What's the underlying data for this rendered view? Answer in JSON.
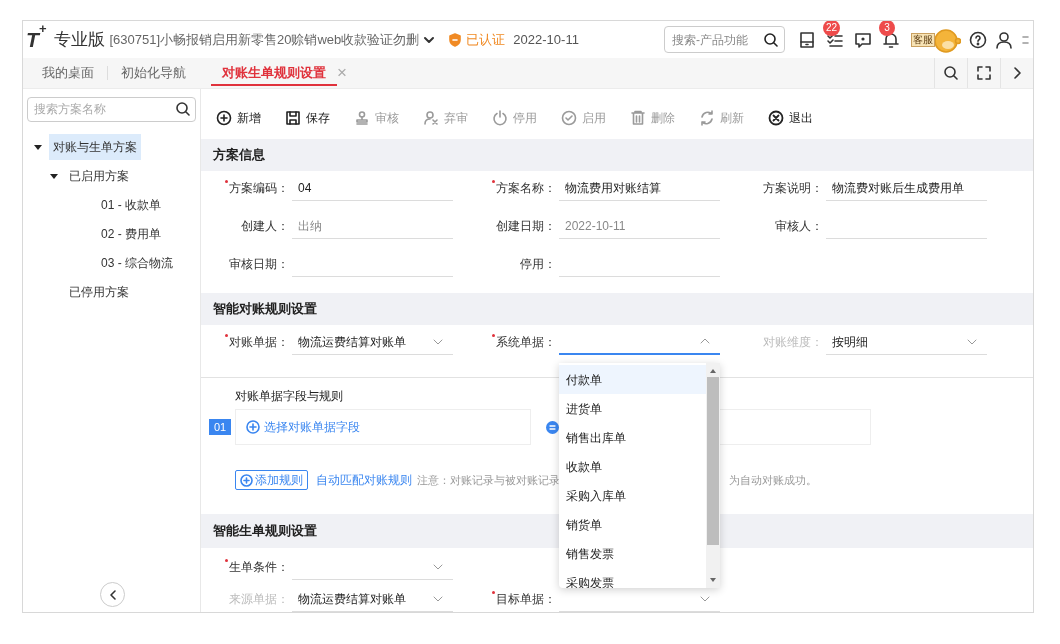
{
  "header": {
    "logo": "T",
    "logo_mark": "+",
    "edition": "专业版",
    "account": "[630751]小畅报销启用新零售20赊销web收款验证勿删",
    "certified": "已认证",
    "date": "2022-10-11",
    "search": {
      "placeholder": "搜索-产品功能"
    },
    "badges": [
      {
        "kind": "save"
      },
      {
        "kind": "tasks",
        "count": "22"
      },
      {
        "kind": "message"
      },
      {
        "kind": "bell",
        "count": "3"
      }
    ],
    "service_label": "客服"
  },
  "tabs": [
    {
      "label": "我的桌面",
      "selected": false,
      "closable": false
    },
    {
      "label": "初始化导航",
      "selected": false,
      "closable": false
    },
    {
      "label": "对账生单规则设置",
      "selected": true,
      "closable": true
    }
  ],
  "tab_close": "×",
  "sidebar": {
    "search": {
      "placeholder": "搜索方案名称"
    },
    "tree": [
      {
        "label": "对账与生单方案",
        "selected": true,
        "expanded": true,
        "children": [
          {
            "label": "已启用方案",
            "selected": false,
            "expanded": true,
            "children": [
              {
                "label": "01 - 收款单",
                "selected": false
              },
              {
                "label": "02 - 费用单",
                "selected": false
              },
              {
                "label": "03 - 综合物流",
                "selected": false
              }
            ]
          },
          {
            "label": "已停用方案",
            "selected": false
          }
        ]
      }
    ]
  },
  "toolbar": [
    {
      "kind": "add",
      "label": "新增",
      "disabled": false
    },
    {
      "kind": "save",
      "label": "保存",
      "disabled": false
    },
    {
      "kind": "audit",
      "label": "审核",
      "disabled": true
    },
    {
      "kind": "unaudit",
      "label": "弃审",
      "disabled": true
    },
    {
      "kind": "stop",
      "label": "停用",
      "disabled": true
    },
    {
      "kind": "enable",
      "label": "启用",
      "disabled": true
    },
    {
      "kind": "delete",
      "label": "删除",
      "disabled": true
    },
    {
      "kind": "refresh",
      "label": "刷新",
      "disabled": true
    },
    {
      "kind": "exit",
      "label": "退出",
      "disabled": false
    }
  ],
  "scheme_info": {
    "title": "方案信息",
    "fields": [
      {
        "label": "方案编码：",
        "required": true,
        "value": "04",
        "readonly": false
      },
      {
        "label": "方案名称：",
        "required": true,
        "value": "物流费用对账结算",
        "readonly": false
      },
      {
        "label": "方案说明：",
        "required": false,
        "value": "物流费对账后生成费用单",
        "readonly": false
      },
      {
        "label": "创建人：",
        "required": false,
        "value": "出纳",
        "readonly": true
      },
      {
        "label": "创建日期：",
        "required": false,
        "value": "2022-10-11",
        "readonly": true
      },
      {
        "label": "审核人：",
        "required": false
      },
      {
        "label": "审核日期：",
        "required": false
      },
      {
        "label": "停用：",
        "required": false
      }
    ]
  },
  "reconcile": {
    "title": "智能对账规则设置",
    "fields": [
      {
        "label": "对账单据：",
        "required": true,
        "value": "物流运费结算对账单",
        "kind": "select",
        "disabled": false,
        "focused": false
      },
      {
        "label": "系统单据：",
        "required": true,
        "kind": "select",
        "disabled": false,
        "focused": true
      },
      {
        "label": "对账维度：",
        "required": false,
        "value": "按明细",
        "kind": "select",
        "disabled": true,
        "focused": false
      }
    ],
    "rules_title": "对账单据字段与规则",
    "rule_index": "01",
    "rule_pick": "选择对账单据字段",
    "add_rule": "添加规则",
    "auto_match": "自动匹配对账规则",
    "notice_visible_start": "注意：对账记录与被对账记录",
    "notice_visible_end": "为自动对账成功。"
  },
  "generate": {
    "title": "智能生单规则设置",
    "fields": [
      {
        "label": "生单条件：",
        "required": true,
        "kind": "select",
        "disabled": false
      },
      {
        "label": "来源单据：",
        "required": false,
        "value": "物流运费结算对账单",
        "kind": "select",
        "disabled": true
      },
      {
        "label": "目标单据：",
        "required": true,
        "kind": "select",
        "disabled": false
      }
    ]
  },
  "dropdown": {
    "options": [
      {
        "label": "付款单",
        "selected": true
      },
      {
        "label": "进货单",
        "selected": false
      },
      {
        "label": "销售出库单",
        "selected": false
      },
      {
        "label": "收款单",
        "selected": false
      },
      {
        "label": "采购入库单",
        "selected": false
      },
      {
        "label": "销货单",
        "selected": false
      },
      {
        "label": "销售发票",
        "selected": false
      },
      {
        "label": "采购发票",
        "selected": false
      }
    ]
  }
}
